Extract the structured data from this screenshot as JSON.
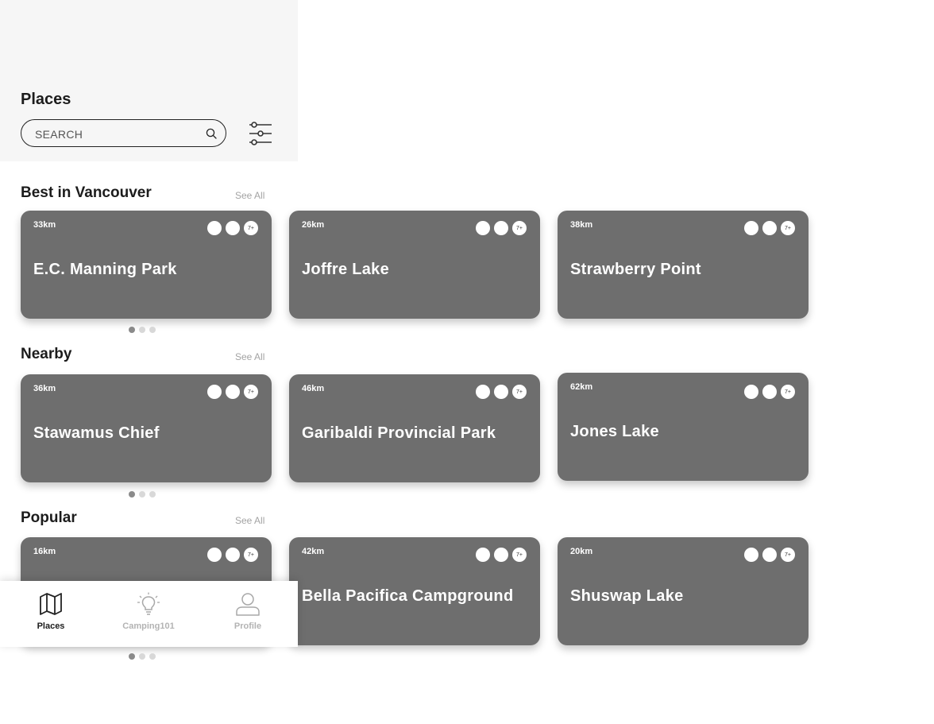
{
  "header": {
    "title": "Places",
    "search_placeholder": "SEARCH"
  },
  "icons": {
    "search": "search-icon",
    "filter": "sliders-icon",
    "places": "map-icon",
    "camping": "lightbulb-icon",
    "profile": "person-icon"
  },
  "sections": [
    {
      "title": "Best in Vancouver",
      "see_all": "See All",
      "cards": [
        {
          "distance": "33km",
          "name": "E.C. Manning Park",
          "badge": "7+"
        },
        {
          "distance": "26km",
          "name": "Joffre Lake",
          "badge": "7+"
        },
        {
          "distance": "38km",
          "name": "Strawberry Point",
          "badge": "7+"
        }
      ]
    },
    {
      "title": "Nearby",
      "see_all": "See All",
      "cards": [
        {
          "distance": "36km",
          "name": "Stawamus Chief",
          "badge": "7+"
        },
        {
          "distance": "46km",
          "name": "Garibaldi Provincial Park",
          "badge": "7+"
        },
        {
          "distance": "62km",
          "name": "Jones Lake",
          "badge": "7+"
        }
      ]
    },
    {
      "title": "Popular",
      "see_all": "See All",
      "cards": [
        {
          "distance": "16km",
          "name": "",
          "badge": "7+"
        },
        {
          "distance": "42km",
          "name": "Bella Pacifica Campground",
          "badge": "7+"
        },
        {
          "distance": "20km",
          "name": "Shuswap Lake",
          "badge": "7+"
        }
      ]
    }
  ],
  "tabbar": {
    "tabs": [
      {
        "label": "Places",
        "active": true
      },
      {
        "label": "Camping101",
        "active": false
      },
      {
        "label": "Profile",
        "active": false
      }
    ]
  },
  "colors": {
    "card": "#6e6e6e",
    "header_bg": "#f6f6f6",
    "inactive_tab": "#b3b3b3"
  }
}
